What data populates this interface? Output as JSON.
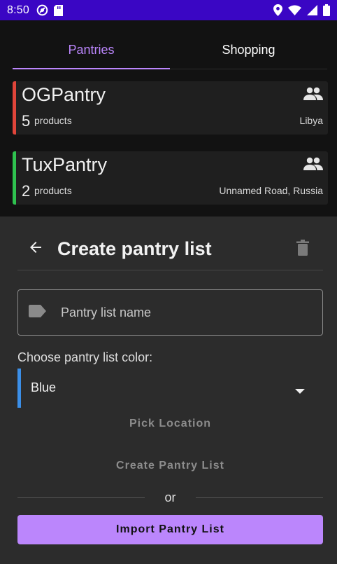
{
  "status_bar": {
    "time": "8:50",
    "icons": [
      "do-not-disturb-icon",
      "sd-card-icon",
      "location-icon",
      "wifi-icon",
      "cellular-icon",
      "battery-icon"
    ]
  },
  "tabs": [
    {
      "label": "Pantries",
      "active": true
    },
    {
      "label": "Shopping",
      "active": false
    }
  ],
  "pantries": [
    {
      "name": "OGPantry",
      "count": "5",
      "count_label": "products",
      "location": "Libya",
      "color": "#e0453a",
      "shared_icon": "group-icon"
    },
    {
      "name": "TuxPantry",
      "count": "2",
      "count_label": "products",
      "location": "Unnamed Road, Russia",
      "color": "#2fc24f",
      "shared_icon": "group-icon"
    }
  ],
  "sheet": {
    "title": "Create pantry list",
    "back_icon": "arrow-back-icon",
    "delete_icon": "delete-icon",
    "name_field": {
      "placeholder": "Pantry list name",
      "icon": "label-icon"
    },
    "color_label": "Choose pantry list color:",
    "color_select": {
      "value": "Blue",
      "color": "#3b8fe8"
    },
    "pick_location": "Pick Location",
    "create_button": "Create Pantry List",
    "or_text": "or",
    "import_button": "Import Pantry List"
  },
  "colors": {
    "accent": "#bb86fc",
    "status_bar": "#3a06c4",
    "sheet_bg": "#2c2c2c",
    "card_bg": "#1f1f1f"
  }
}
